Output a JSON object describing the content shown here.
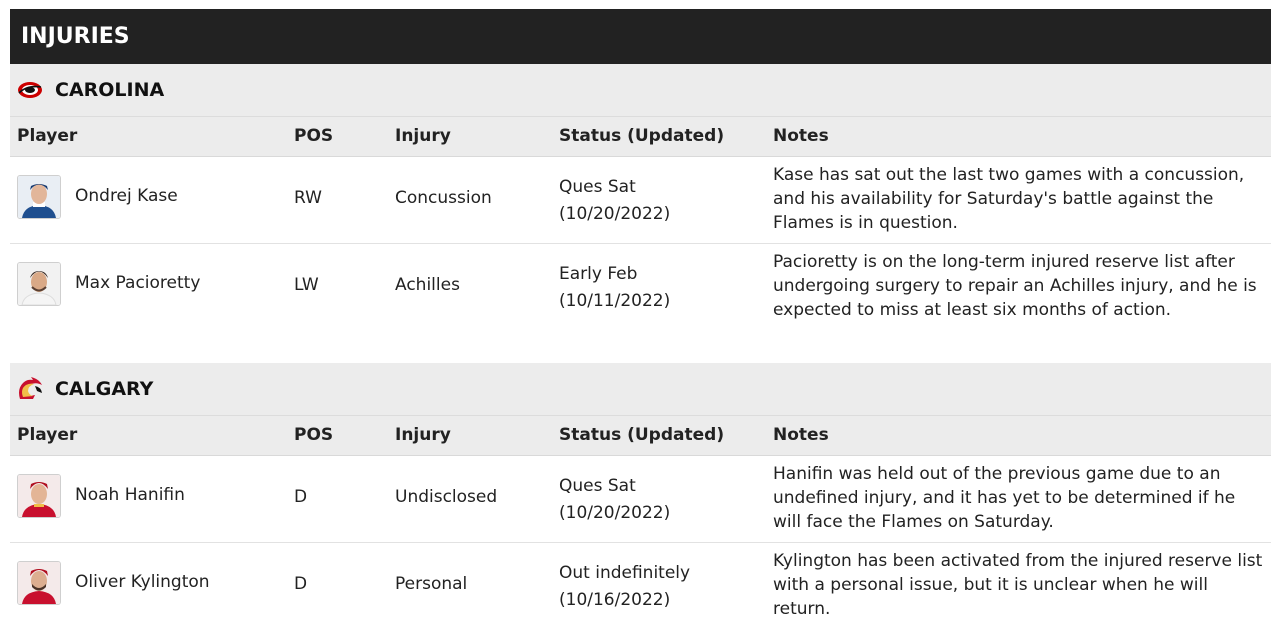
{
  "header": {
    "title": "INJURIES"
  },
  "columns": {
    "player": "Player",
    "pos": "POS",
    "injury": "Injury",
    "status": "Status (Updated)",
    "notes": "Notes"
  },
  "teams": [
    {
      "name": "CAROLINA",
      "logo_icon": "hurricanes-logo-icon",
      "players": [
        {
          "name": "Ondrej Kase",
          "pos": "RW",
          "injury": "Concussion",
          "status": "Ques Sat",
          "updated": "(10/20/2022)",
          "notes": "Kase has sat out the last two games with a concussion, and his availability for Saturday's battle against the Flames is in question."
        },
        {
          "name": "Max Pacioretty",
          "pos": "LW",
          "injury": "Achilles",
          "status": "Early Feb",
          "updated": "(10/11/2022)",
          "notes": "Pacioretty is on the long-term injured reserve list after undergoing surgery to repair an Achilles injury, and he is expected to miss at least six months of action."
        }
      ]
    },
    {
      "name": "CALGARY",
      "logo_icon": "flames-logo-icon",
      "players": [
        {
          "name": "Noah Hanifin",
          "pos": "D",
          "injury": "Undisclosed",
          "status": "Ques Sat",
          "updated": "(10/20/2022)",
          "notes": "Hanifin was held out of the previous game due to an undefined injury, and it has yet to be determined if he will face the Flames on Saturday."
        },
        {
          "name": "Oliver Kylington",
          "pos": "D",
          "injury": "Personal",
          "status": "Out indefinitely",
          "updated": "(10/16/2022)",
          "notes": "Kylington has been activated from the injured reserve list with a personal issue, but it is unclear when he will return."
        }
      ]
    }
  ],
  "colors": {
    "header_bg": "#222222",
    "section_bg": "#ececec",
    "hurricanes_red": "#cc0000",
    "flames_red": "#c8102e",
    "flames_yellow": "#f1be48"
  }
}
